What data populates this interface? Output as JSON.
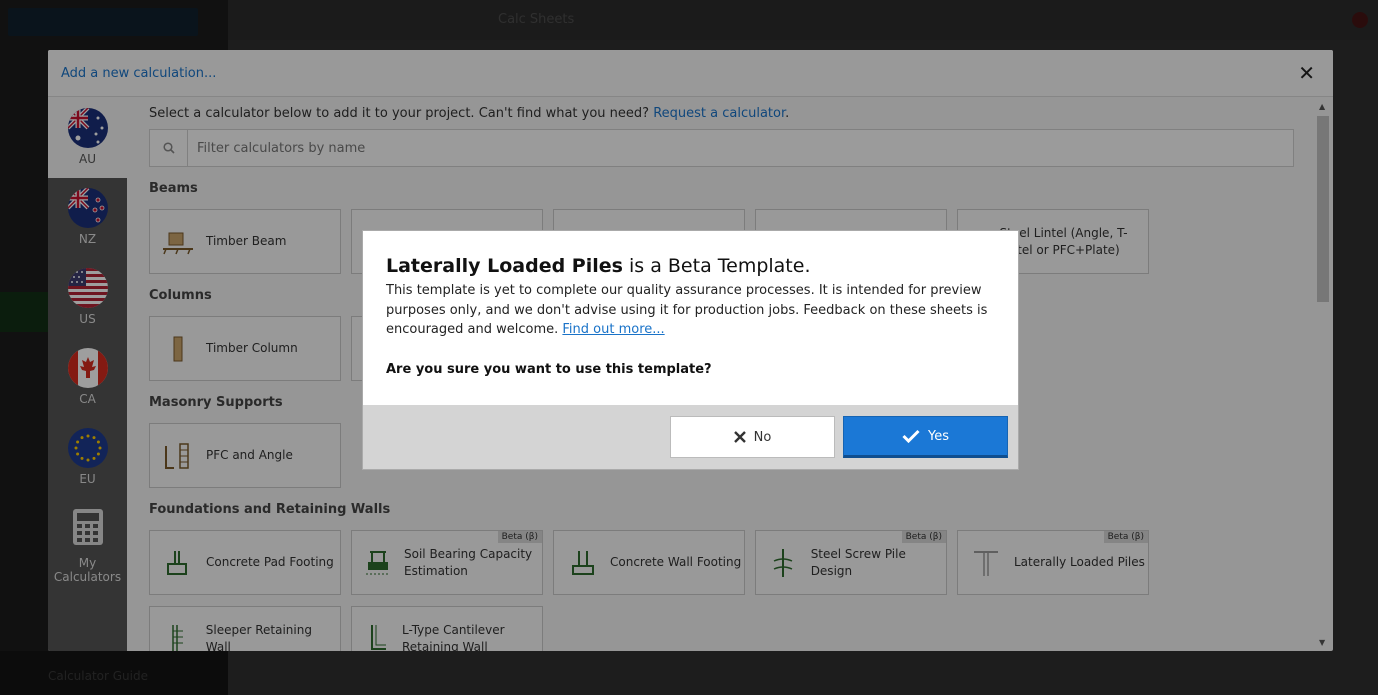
{
  "background": {
    "title": "Calc Sheets",
    "footer_text": "Calculator Guide"
  },
  "modal": {
    "title": "Add a new calculation...",
    "intro_text": "Select a calculator below to add it to your project. Can't find what you need? ",
    "intro_link": "Request a calculator",
    "intro_end": ".",
    "filter_placeholder": "Filter calculators by name"
  },
  "regions": [
    {
      "code": "AU"
    },
    {
      "code": "NZ"
    },
    {
      "code": "US"
    },
    {
      "code": "CA"
    },
    {
      "code": "EU"
    },
    {
      "code": "My Calculators"
    }
  ],
  "sections": {
    "beams": {
      "title": "Beams",
      "cards": [
        "Timber Beam",
        "",
        "",
        "",
        "Steel Lintel (Angle, T-Lintel or PFC+Plate)"
      ]
    },
    "columns": {
      "title": "Columns",
      "cards": [
        "Timber Column",
        ""
      ]
    },
    "masonry": {
      "title": "Masonry Supports",
      "cards": [
        "PFC and Angle"
      ]
    },
    "foundations": {
      "title": "Foundations and Retaining Walls",
      "cards": [
        {
          "label": "Concrete Pad Footing",
          "beta": ""
        },
        {
          "label": "Soil Bearing Capacity Estimation",
          "beta": "Beta (β)"
        },
        {
          "label": "Concrete Wall Footing",
          "beta": ""
        },
        {
          "label": "Steel Screw Pile Design",
          "beta": "Beta (β)"
        },
        {
          "label": "Laterally Loaded Piles",
          "beta": "Beta (β)"
        }
      ],
      "cards_row2": [
        "Sleeper Retaining Wall",
        "L-Type Cantilever Retaining Wall"
      ]
    }
  },
  "dialog": {
    "heading_bold": "Laterally Loaded Piles",
    "heading_rest": " is a Beta Template.",
    "text": "This template is yet to complete our quality assurance processes. It is intended for preview purposes only, and we don't advise using it for production jobs. Feedback on these sheets is encouraged and welcome. ",
    "link": "Find out more...",
    "question": "Are you sure you want to use this template?",
    "no_label": "No",
    "yes_label": "Yes"
  },
  "colors": {
    "accent": "#1b78d6",
    "link": "#1a73c8",
    "icon_green": "#2e6b2e"
  }
}
